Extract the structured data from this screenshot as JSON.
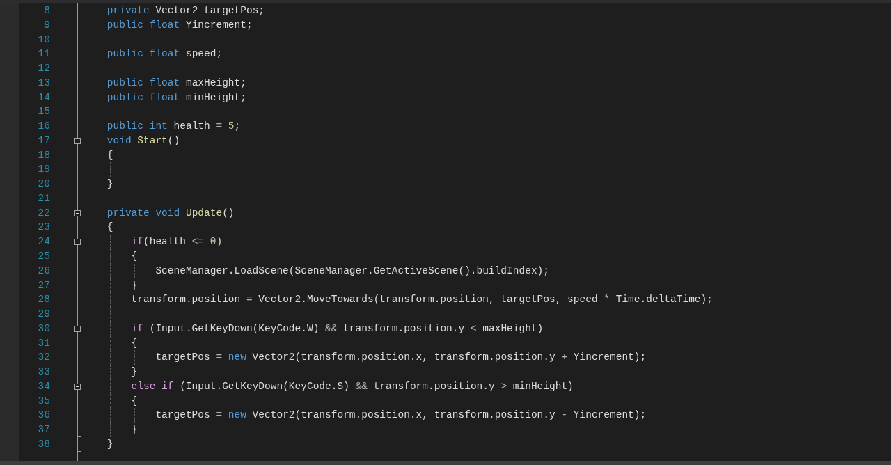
{
  "code": [
    {
      "kind": "block",
      "children": [
        {
          "kind": "line",
          "number": "8",
          "tokens": [
            {
              "kind": "keyword",
              "text": "private"
            },
            {
              "kind": "plain",
              "text": " Vector2 targetPos;"
            }
          ]
        },
        {
          "kind": "line",
          "number": "9",
          "tokens": [
            {
              "kind": "keyword",
              "text": "public "
            },
            {
              "kind": "keyword",
              "text": "float"
            },
            {
              "kind": "plain",
              "text": " Yincrement;"
            }
          ]
        },
        {
          "kind": "line",
          "number": "10"
        },
        {
          "kind": "line",
          "number": "11",
          "tokens": [
            {
              "kind": "keyword",
              "text": "public "
            },
            {
              "kind": "keyword",
              "text": "float"
            },
            {
              "kind": "plain",
              "text": " speed;"
            }
          ]
        },
        {
          "kind": "line",
          "number": "12"
        },
        {
          "kind": "line",
          "number": "13",
          "tokens": [
            {
              "kind": "keyword",
              "text": "public "
            },
            {
              "kind": "keyword",
              "text": "float"
            },
            {
              "kind": "plain",
              "text": " maxHeight;"
            }
          ]
        },
        {
          "kind": "line",
          "number": "14",
          "tokens": [
            {
              "kind": "keyword",
              "text": "public "
            },
            {
              "kind": "keyword",
              "text": "float"
            },
            {
              "kind": "plain",
              "text": " minHeight;"
            }
          ]
        },
        {
          "kind": "line",
          "number": "15"
        },
        {
          "kind": "line",
          "number": "16",
          "tokens": [
            {
              "kind": "keyword",
              "text": "public "
            },
            {
              "kind": "keyword",
              "text": "int"
            },
            {
              "kind": "plain",
              "text": " health "
            },
            {
              "kind": "operator",
              "text": "= "
            },
            {
              "kind": "number",
              "text": "5"
            },
            {
              "kind": "plain",
              "text": ";"
            }
          ]
        },
        {
          "kind": "line",
          "number": "17",
          "fold": {
            "kind": "toggle",
            "expanded": true
          },
          "tokens": [
            {
              "kind": "keyword",
              "text": "void "
            },
            {
              "kind": "method",
              "text": "Start"
            },
            {
              "kind": "plain",
              "text": "()"
            }
          ]
        },
        {
          "kind": "line",
          "number": "18",
          "tokens": [
            {
              "kind": "plain",
              "text": "{"
            }
          ]
        },
        {
          "kind": "block",
          "children": [
            {
              "kind": "line",
              "number": "19"
            }
          ]
        },
        {
          "kind": "line",
          "number": "20",
          "fold": {
            "kind": "end"
          },
          "tokens": [
            {
              "kind": "plain",
              "text": "}"
            }
          ]
        },
        {
          "kind": "line",
          "number": "21"
        },
        {
          "kind": "line",
          "number": "22",
          "fold": {
            "kind": "toggle",
            "expanded": true
          },
          "tokens": [
            {
              "kind": "keyword",
              "text": "private "
            },
            {
              "kind": "keyword",
              "text": "void "
            },
            {
              "kind": "method",
              "text": "Update"
            },
            {
              "kind": "plain",
              "text": "()"
            }
          ]
        },
        {
          "kind": "line",
          "number": "23",
          "tokens": [
            {
              "kind": "plain",
              "text": "{"
            }
          ]
        },
        {
          "kind": "block",
          "children": [
            {
              "kind": "line",
              "number": "24",
              "fold": {
                "kind": "toggle",
                "expanded": true
              },
              "tokens": [
                {
                  "kind": "control",
                  "text": "if"
                },
                {
                  "kind": "plain",
                  "text": "(health "
                },
                {
                  "kind": "operator",
                  "text": "<= "
                },
                {
                  "kind": "number",
                  "text": "0"
                },
                {
                  "kind": "plain",
                  "text": ")"
                }
              ]
            },
            {
              "kind": "line",
              "number": "25",
              "tokens": [
                {
                  "kind": "plain",
                  "text": "{"
                }
              ]
            },
            {
              "kind": "block",
              "children": [
                {
                  "kind": "line",
                  "number": "26",
                  "tokens": [
                    {
                      "kind": "plain",
                      "text": "SceneManager.LoadScene(SceneManager.GetActiveScene().buildIndex);"
                    }
                  ]
                }
              ]
            },
            {
              "kind": "line",
              "number": "27",
              "fold": {
                "kind": "end"
              },
              "tokens": [
                {
                  "kind": "plain",
                  "text": "}"
                }
              ]
            },
            {
              "kind": "line",
              "number": "28",
              "tokens": [
                {
                  "kind": "plain",
                  "text": "transform.position "
                },
                {
                  "kind": "operator",
                  "text": "="
                },
                {
                  "kind": "plain",
                  "text": " Vector2.MoveTowards(transform.position, targetPos, speed "
                },
                {
                  "kind": "operator",
                  "text": "*"
                },
                {
                  "kind": "plain",
                  "text": " Time.deltaTime);"
                }
              ]
            },
            {
              "kind": "line",
              "number": "29"
            },
            {
              "kind": "line",
              "number": "30",
              "fold": {
                "kind": "toggle",
                "expanded": true
              },
              "tokens": [
                {
                  "kind": "control",
                  "text": "if"
                },
                {
                  "kind": "plain",
                  "text": " (Input.GetKeyDown(KeyCode.W) "
                },
                {
                  "kind": "operator",
                  "text": "&&"
                },
                {
                  "kind": "plain",
                  "text": " transform.position.y "
                },
                {
                  "kind": "operator",
                  "text": "<"
                },
                {
                  "kind": "plain",
                  "text": " maxHeight)"
                }
              ]
            },
            {
              "kind": "line",
              "number": "31",
              "tokens": [
                {
                  "kind": "plain",
                  "text": "{"
                }
              ]
            },
            {
              "kind": "block",
              "children": [
                {
                  "kind": "line",
                  "number": "32",
                  "tokens": [
                    {
                      "kind": "plain",
                      "text": "targetPos "
                    },
                    {
                      "kind": "operator",
                      "text": "= "
                    },
                    {
                      "kind": "keyword",
                      "text": "new"
                    },
                    {
                      "kind": "plain",
                      "text": " Vector2(transform.position.x, transform.position.y "
                    },
                    {
                      "kind": "operator",
                      "text": "+"
                    },
                    {
                      "kind": "plain",
                      "text": " Yincrement);"
                    }
                  ]
                }
              ]
            },
            {
              "kind": "line",
              "number": "33",
              "fold": {
                "kind": "end"
              },
              "tokens": [
                {
                  "kind": "plain",
                  "text": "}"
                }
              ]
            },
            {
              "kind": "line",
              "number": "34",
              "fold": {
                "kind": "toggle",
                "expanded": true
              },
              "tokens": [
                {
                  "kind": "control",
                  "text": "else "
                },
                {
                  "kind": "control",
                  "text": "if"
                },
                {
                  "kind": "plain",
                  "text": " (Input.GetKeyDown(KeyCode.S) "
                },
                {
                  "kind": "operator",
                  "text": "&&"
                },
                {
                  "kind": "plain",
                  "text": " transform.position.y "
                },
                {
                  "kind": "operator",
                  "text": ">"
                },
                {
                  "kind": "plain",
                  "text": " minHeight)"
                }
              ]
            },
            {
              "kind": "line",
              "number": "35",
              "tokens": [
                {
                  "kind": "plain",
                  "text": "{"
                }
              ]
            },
            {
              "kind": "block",
              "children": [
                {
                  "kind": "line",
                  "number": "36",
                  "tokens": [
                    {
                      "kind": "plain",
                      "text": "targetPos "
                    },
                    {
                      "kind": "operator",
                      "text": "= "
                    },
                    {
                      "kind": "keyword",
                      "text": "new"
                    },
                    {
                      "kind": "plain",
                      "text": " Vector2(transform.position.x, transform.position.y "
                    },
                    {
                      "kind": "operator",
                      "text": "-"
                    },
                    {
                      "kind": "plain",
                      "text": " Yincrement);"
                    }
                  ]
                }
              ]
            },
            {
              "kind": "line",
              "number": "37",
              "fold": {
                "kind": "end"
              },
              "tokens": [
                {
                  "kind": "plain",
                  "text": "}"
                }
              ]
            }
          ]
        },
        {
          "kind": "line",
          "number": "38",
          "fold": {
            "kind": "end"
          },
          "tokens": [
            {
              "kind": "plain",
              "text": "}"
            }
          ]
        }
      ]
    }
  ]
}
